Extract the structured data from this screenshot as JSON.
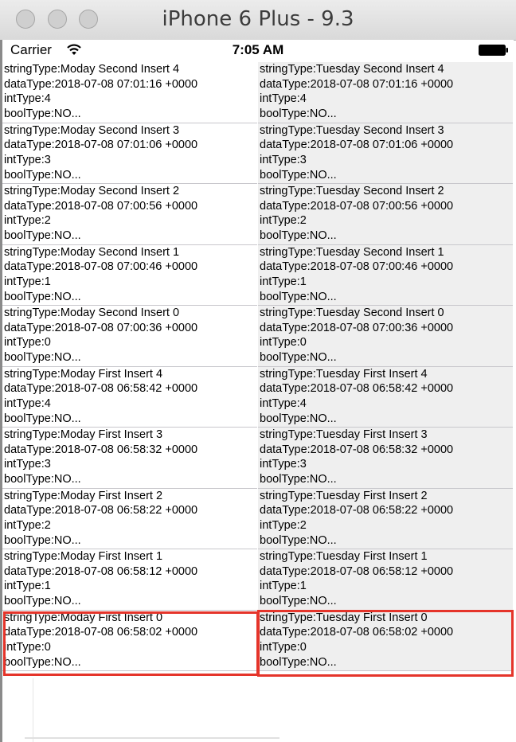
{
  "window": {
    "title": "iPhone 6 Plus - 9.3"
  },
  "statusbar": {
    "carrier": "Carrier",
    "time": "7:05 AM",
    "wifi_icon": "wifi-icon",
    "battery_icon": "battery-icon"
  },
  "colors": {
    "highlight": "#e5342a",
    "right_column_bg": "#efefef",
    "separator": "#c8c7cc"
  },
  "left_rows": [
    {
      "string": "stringType:Moday Second Insert 4",
      "date": "dataType:2018-07-08 07:01:16 +0000",
      "int": "intType:4",
      "bool": "boolType:NO..."
    },
    {
      "string": "stringType:Moday Second Insert 3",
      "date": "dataType:2018-07-08 07:01:06 +0000",
      "int": "intType:3",
      "bool": "boolType:NO..."
    },
    {
      "string": "stringType:Moday Second Insert 2",
      "date": "dataType:2018-07-08 07:00:56 +0000",
      "int": "intType:2",
      "bool": "boolType:NO..."
    },
    {
      "string": "stringType:Moday Second Insert 1",
      "date": "dataType:2018-07-08 07:00:46 +0000",
      "int": "intType:1",
      "bool": "boolType:NO..."
    },
    {
      "string": "stringType:Moday Second Insert 0",
      "date": "dataType:2018-07-08 07:00:36 +0000",
      "int": "intType:0",
      "bool": "boolType:NO..."
    },
    {
      "string": "stringType:Moday First Insert 4",
      "date": "dataType:2018-07-08 06:58:42 +0000",
      "int": "intType:4",
      "bool": "boolType:NO..."
    },
    {
      "string": "stringType:Moday First Insert 3",
      "date": "dataType:2018-07-08 06:58:32 +0000",
      "int": "intType:3",
      "bool": "boolType:NO..."
    },
    {
      "string": "stringType:Moday First Insert 2",
      "date": "dataType:2018-07-08 06:58:22 +0000",
      "int": "intType:2",
      "bool": "boolType:NO..."
    },
    {
      "string": "stringType:Moday First Insert 1",
      "date": "dataType:2018-07-08 06:58:12 +0000",
      "int": "intType:1",
      "bool": "boolType:NO..."
    },
    {
      "string": "stringType:Moday First Insert 0",
      "date": "dataType:2018-07-08 06:58:02 +0000",
      "int": "intType:0",
      "bool": "boolType:NO..."
    }
  ],
  "right_rows": [
    {
      "string": "stringType:Tuesday Second Insert 4",
      "date": "dataType:2018-07-08 07:01:16 +0000",
      "int": "intType:4",
      "bool": "boolType:NO..."
    },
    {
      "string": "stringType:Tuesday Second Insert 3",
      "date": "dataType:2018-07-08 07:01:06 +0000",
      "int": "intType:3",
      "bool": "boolType:NO..."
    },
    {
      "string": "stringType:Tuesday Second Insert 2",
      "date": "dataType:2018-07-08 07:00:56 +0000",
      "int": "intType:2",
      "bool": "boolType:NO..."
    },
    {
      "string": "stringType:Tuesday Second Insert 1",
      "date": "dataType:2018-07-08 07:00:46 +0000",
      "int": "intType:1",
      "bool": "boolType:NO..."
    },
    {
      "string": "stringType:Tuesday Second Insert 0",
      "date": "dataType:2018-07-08 07:00:36 +0000",
      "int": "intType:0",
      "bool": "boolType:NO..."
    },
    {
      "string": "stringType:Tuesday First Insert 4",
      "date": "dataType:2018-07-08 06:58:42 +0000",
      "int": "intType:4",
      "bool": "boolType:NO..."
    },
    {
      "string": "stringType:Tuesday First Insert 3",
      "date": "dataType:2018-07-08 06:58:32 +0000",
      "int": "intType:3",
      "bool": "boolType:NO..."
    },
    {
      "string": "stringType:Tuesday First Insert 2",
      "date": "dataType:2018-07-08 06:58:22 +0000",
      "int": "intType:2",
      "bool": "boolType:NO..."
    },
    {
      "string": "stringType:Tuesday First Insert 1",
      "date": "dataType:2018-07-08 06:58:12 +0000",
      "int": "intType:1",
      "bool": "boolType:NO..."
    },
    {
      "string": "stringType:Tuesday First Insert 0",
      "date": "dataType:2018-07-08 06:58:02 +0000",
      "int": "intType:0",
      "bool": "boolType:NO..."
    }
  ]
}
